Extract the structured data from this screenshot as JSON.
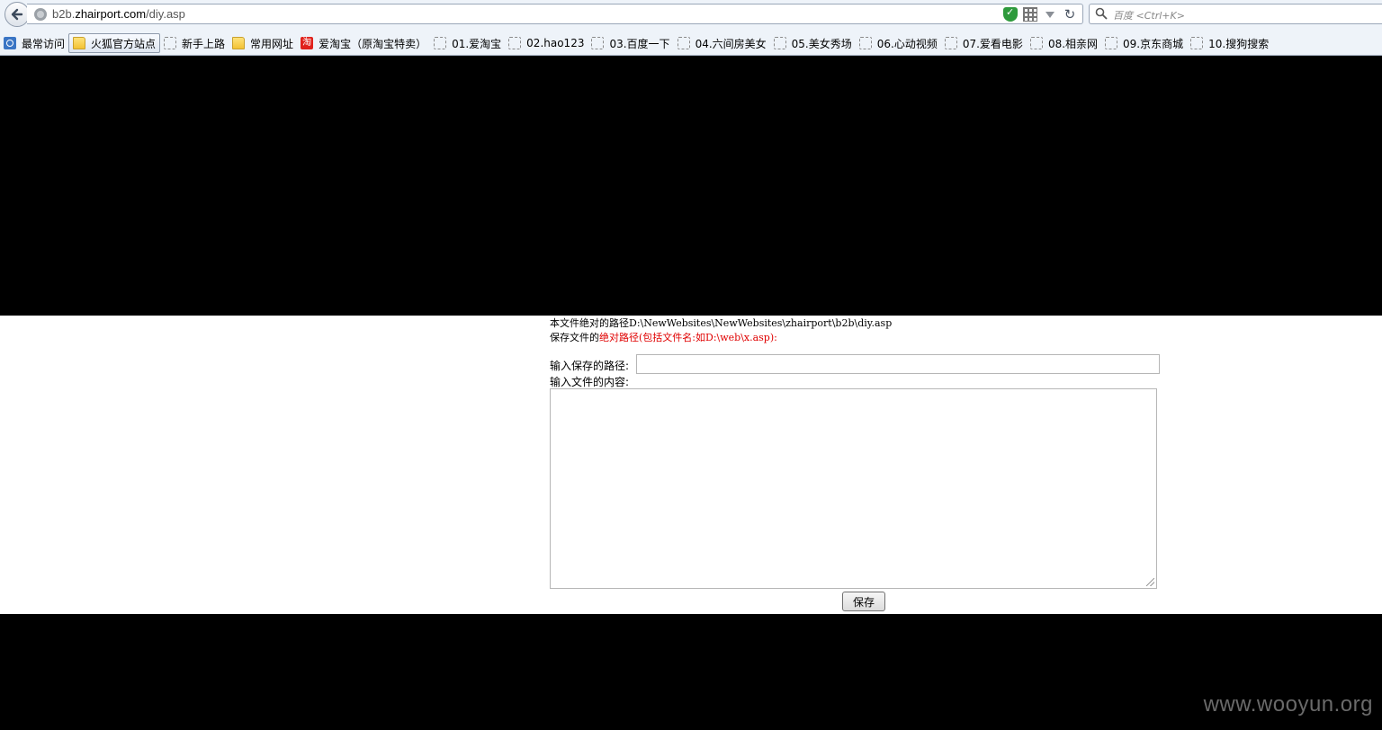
{
  "browser": {
    "url_prefix": "b2b.",
    "url_domain": "zhairport.com",
    "url_path": "/diy.asp",
    "search_placeholder": "百度 <Ctrl+K>"
  },
  "bookmarks": [
    {
      "label": "最常访问",
      "icon": "history-icon"
    },
    {
      "label": "火狐官方站点",
      "icon": "folder-icon",
      "active": true
    },
    {
      "label": "新手上路",
      "icon": "page-icon"
    },
    {
      "label": "常用网址",
      "icon": "folder-icon"
    },
    {
      "label": "爱淘宝（原淘宝特卖）",
      "icon": "taobao-icon",
      "glyph": "淘"
    },
    {
      "label": "01.爱淘宝",
      "icon": "page-icon"
    },
    {
      "label": "02.hao123",
      "icon": "page-icon"
    },
    {
      "label": "03.百度一下",
      "icon": "page-icon"
    },
    {
      "label": "04.六间房美女",
      "icon": "page-icon"
    },
    {
      "label": "05.美女秀场",
      "icon": "page-icon"
    },
    {
      "label": "06.心动视频",
      "icon": "page-icon"
    },
    {
      "label": "07.爱看电影",
      "icon": "page-icon"
    },
    {
      "label": "08.相亲网",
      "icon": "page-icon"
    },
    {
      "label": "09.京东商城",
      "icon": "page-icon"
    },
    {
      "label": "10.搜狗搜索",
      "icon": "page-icon"
    }
  ],
  "page": {
    "abs_path_label": "本文件绝对的路径",
    "abs_path_value": "D:\\NewWebsites\\NewWebsites\\zhairport\\b2b\\diy.asp",
    "save_prefix": "保存文件的",
    "save_red": "绝对路径(包括文件名:如D:\\web\\x.asp):",
    "path_input_label": "输入保存的路径:",
    "path_input_value": "",
    "content_label": "输入文件的内容:",
    "content_value": "",
    "save_button": "保存"
  },
  "watermark": "www.wooyun.org"
}
